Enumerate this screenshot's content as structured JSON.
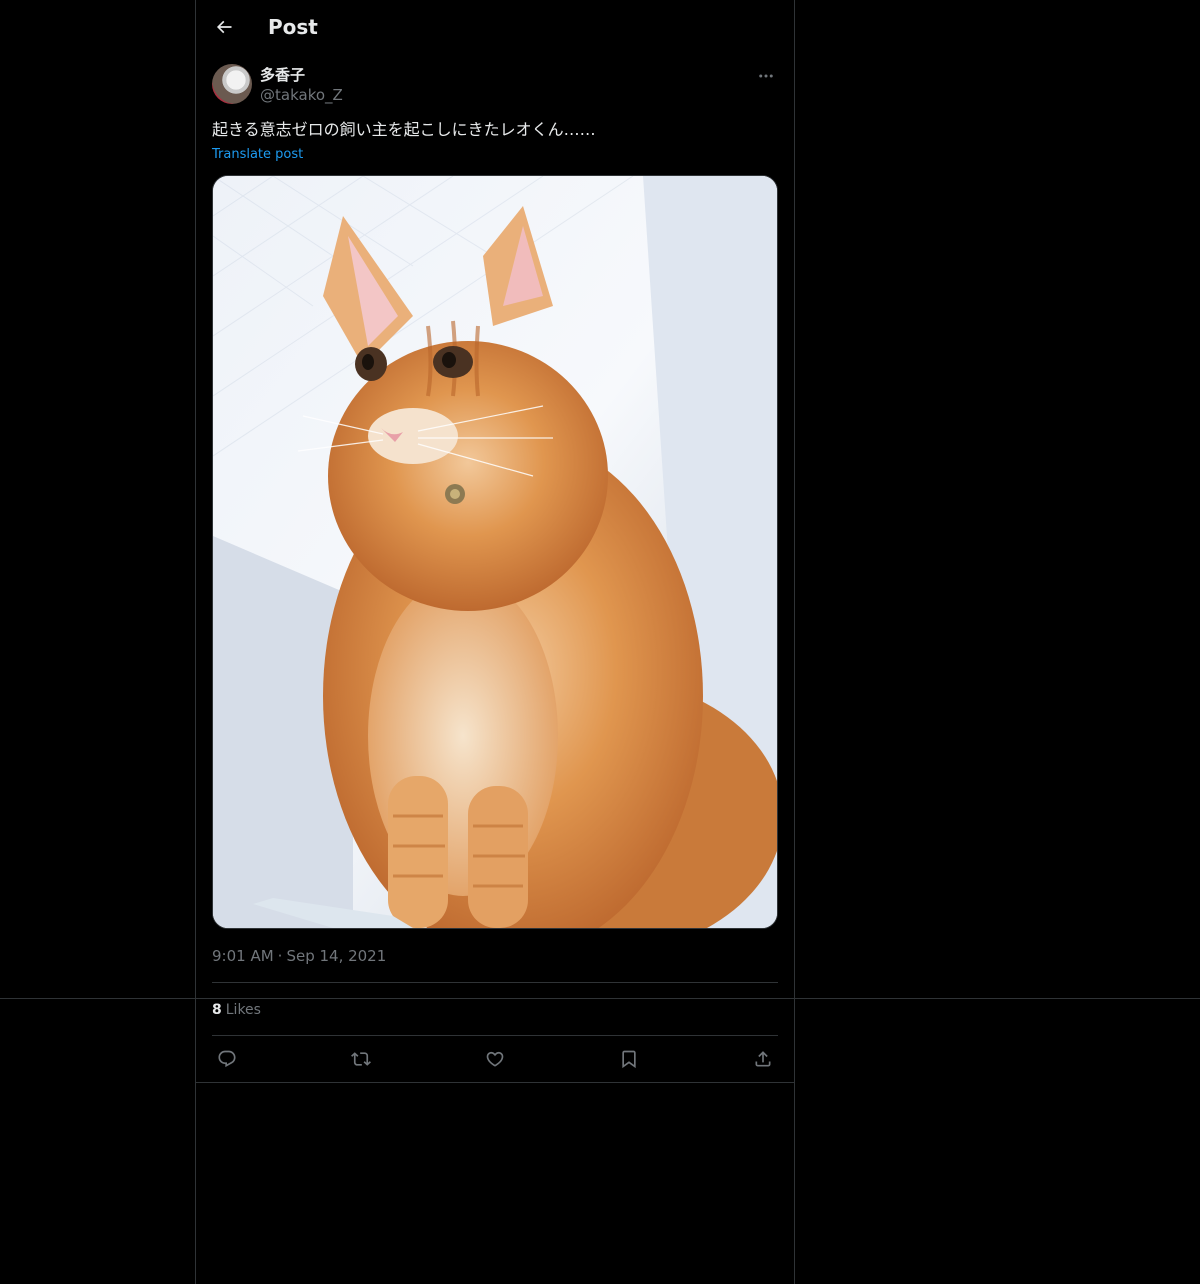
{
  "header": {
    "back_icon": "arrow-left-icon",
    "title": "Post"
  },
  "post": {
    "author": {
      "display_name": "多香子",
      "handle": "@takako_Z",
      "avatar_icon": "avatar-photo"
    },
    "more_icon": "ellipsis-icon",
    "text": "起きる意志ゼロの飼い主を起こしにきたレオくん……",
    "translate_label": "Translate post",
    "media_icon": "photo-orange-cat",
    "time": "9:01 AM",
    "separator": "·",
    "date": "Sep 14, 2021",
    "likes": {
      "count": "8",
      "label": "Likes"
    },
    "actions": [
      {
        "name": "reply",
        "icon": "reply-icon"
      },
      {
        "name": "repost",
        "icon": "repost-icon"
      },
      {
        "name": "like",
        "icon": "heart-icon"
      },
      {
        "name": "bookmark",
        "icon": "bookmark-icon"
      },
      {
        "name": "share",
        "icon": "share-icon"
      }
    ]
  },
  "colors": {
    "background": "#000000",
    "text_primary": "#e7e9ea",
    "text_secondary": "#71767b",
    "link": "#1d9bf0",
    "border": "#2f3336"
  }
}
